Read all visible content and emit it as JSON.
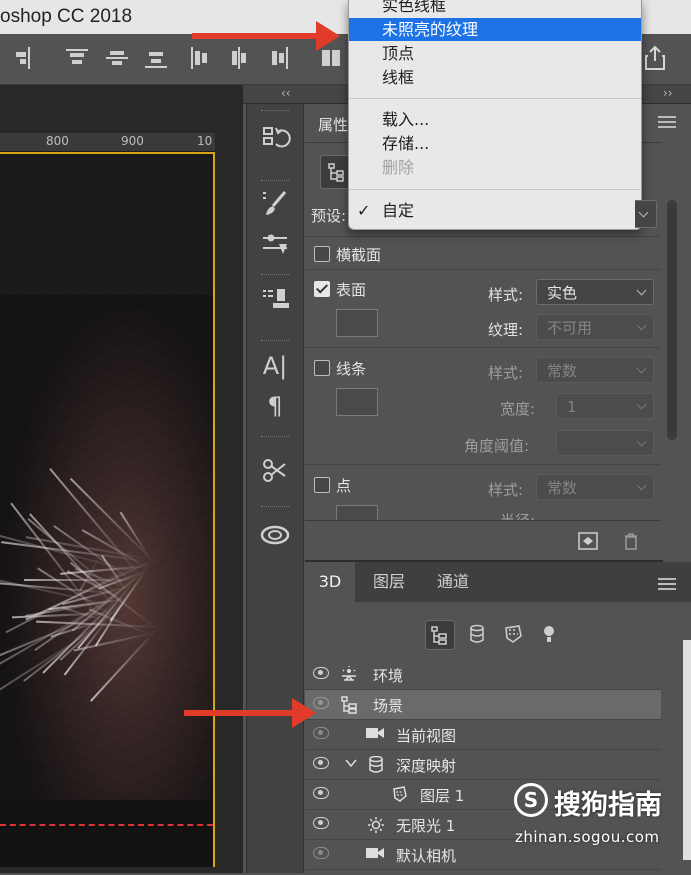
{
  "app_title": "oshop CC 2018",
  "ruler_ticks": [
    "800",
    "900",
    "10"
  ],
  "collapse_left": "‹‹",
  "collapse_right": "››",
  "properties": {
    "tab_label": "属性",
    "preset_label": "预设:",
    "cross_section": "横截面",
    "surface": {
      "label": "表面",
      "checked": true,
      "style_label": "样式:",
      "style_value": "实色",
      "texture_label": "纹理:",
      "texture_value": "不可用"
    },
    "lines": {
      "label": "线条",
      "checked": false,
      "style_label": "样式:",
      "style_value": "常数",
      "width_label": "宽度:",
      "width_value": "1",
      "angle_label": "角度阈值:"
    },
    "points": {
      "label": "点",
      "checked": false,
      "style_label": "样式:",
      "style_value": "常数",
      "radius_label": "半径:"
    }
  },
  "preset_menu": {
    "items": [
      {
        "label": "实色线框",
        "state": "normal"
      },
      {
        "label": "未照亮的纹理",
        "state": "highlighted"
      },
      {
        "label": "顶点",
        "state": "normal"
      },
      {
        "label": "线框",
        "state": "normal"
      },
      {
        "label": "载入...",
        "state": "normal"
      },
      {
        "label": "存储...",
        "state": "normal"
      },
      {
        "label": "删除",
        "state": "disabled"
      },
      {
        "label": "自定",
        "state": "checked"
      }
    ],
    "checkmark": "✓"
  },
  "panel_tabs": [
    {
      "label": "3D",
      "active": true
    },
    {
      "label": "图层",
      "active": false
    },
    {
      "label": "通道",
      "active": false
    }
  ],
  "filter_icons": [
    "scene-filter-icon",
    "mesh-filter-icon",
    "material-filter-icon",
    "light-filter-icon"
  ],
  "layers": [
    {
      "name": "环境",
      "icon": "environment-icon",
      "indent": 0,
      "selected": false
    },
    {
      "name": "场景",
      "icon": "scene-icon",
      "indent": 0,
      "selected": true
    },
    {
      "name": "当前视图",
      "icon": "camera-icon",
      "indent": 1,
      "selected": false
    },
    {
      "name": "深度映射",
      "icon": "mesh-icon",
      "indent": 1,
      "selected": false,
      "expanded": true
    },
    {
      "name": "图层 1",
      "icon": "material-icon",
      "indent": 2,
      "selected": false
    },
    {
      "name": "无限光 1",
      "icon": "infinite-light-icon",
      "indent": 1,
      "selected": false
    },
    {
      "name": "默认相机",
      "icon": "camera-icon",
      "indent": 1,
      "selected": false
    }
  ],
  "watermark": {
    "logo_char": "S",
    "brand": "搜狗指南",
    "url": "zhinan.sogou.com"
  },
  "colors": {
    "accent_highlight": "#1d72e6",
    "annotation_arrow": "#e23b2a",
    "canvas_frame": "#d6a614"
  }
}
